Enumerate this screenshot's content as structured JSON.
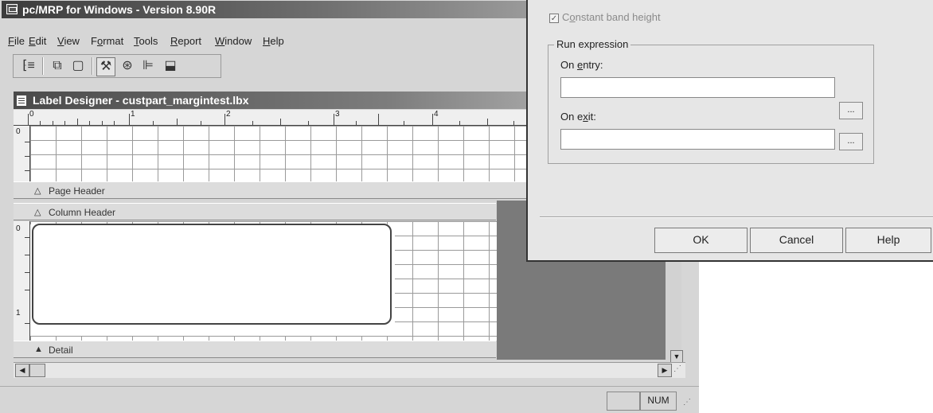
{
  "app": {
    "title": "pc/MRP for Windows - Version 8.90R"
  },
  "menu": {
    "items": [
      {
        "pre": "",
        "key": "F",
        "post": "ile"
      },
      {
        "pre": "",
        "key": "E",
        "post": "dit"
      },
      {
        "pre": "",
        "key": "V",
        "post": "iew"
      },
      {
        "pre": "F",
        "key": "o",
        "post": "rmat"
      },
      {
        "pre": "",
        "key": "T",
        "post": "ools"
      },
      {
        "pre": "",
        "key": "R",
        "post": "eport"
      },
      {
        "pre": "",
        "key": "W",
        "post": "indow"
      },
      {
        "pre": "",
        "key": "H",
        "post": "elp"
      }
    ]
  },
  "toolbar": {
    "icons": [
      "properties-icon",
      "data-environment-icon",
      "page-icon",
      "tools-icon",
      "code-icon",
      "align-icon",
      "paint-icon"
    ]
  },
  "designer": {
    "title": "Label Designer - custpart_margintest.lbx",
    "ruler": {
      "labels": [
        "0",
        "1",
        "2",
        "3",
        "4"
      ]
    },
    "vruler1": {
      "label": "0"
    },
    "vruler2": {
      "labels": [
        "0",
        "1"
      ]
    },
    "bands": {
      "page_header": "Page Header",
      "column_header": "Column Header",
      "detail": "Detail"
    }
  },
  "status": {
    "num": "NUM"
  },
  "dialog": {
    "constant_band": {
      "pre": "C",
      "key": "o",
      "post": "nstant band height",
      "checked": true
    },
    "group_title": "Run expression",
    "on_entry": {
      "pre": "On ",
      "key": "e",
      "post": "ntry:",
      "value": ""
    },
    "on_exit": {
      "pre": "On e",
      "key": "x",
      "post": "it:",
      "value": ""
    },
    "ellipsis": "...",
    "buttons": {
      "ok": "OK",
      "cancel": "Cancel",
      "help": "Help"
    }
  }
}
